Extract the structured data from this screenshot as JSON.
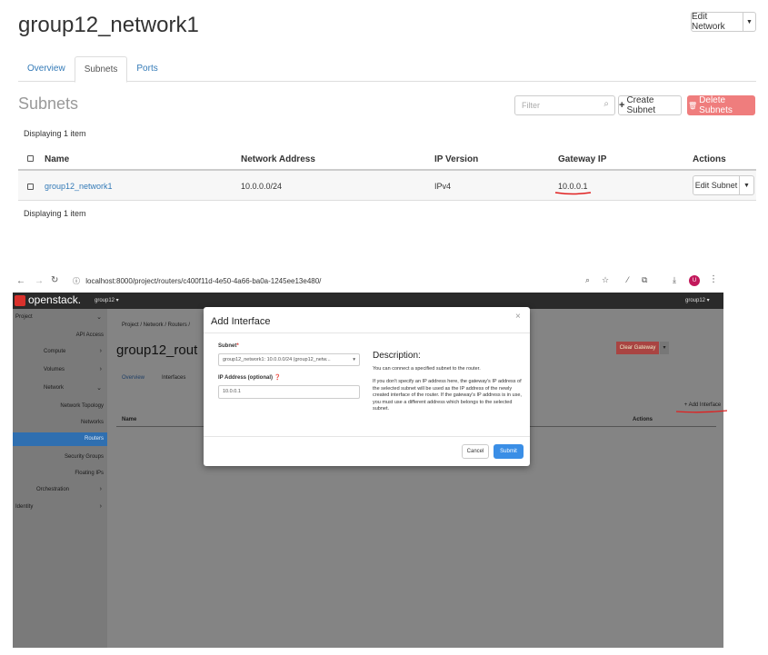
{
  "network": {
    "title": "group12_network1",
    "edit_button": "Edit Network",
    "tabs": [
      "Overview",
      "Subnets",
      "Ports"
    ],
    "active_tab": "Subnets"
  },
  "subnets": {
    "section_title": "Subnets",
    "filter_placeholder": "Filter",
    "create_button": "Create Subnet",
    "delete_button": "Delete Subnets",
    "display_count": "Displaying 1 item",
    "columns": [
      "Name",
      "Network Address",
      "IP Version",
      "Gateway IP",
      "Actions"
    ],
    "rows": [
      {
        "name": "group12_network1",
        "network_address": "10.0.0.0/24",
        "ip_version": "IPv4",
        "gateway_ip": "10.0.0.1",
        "action": "Edit Subnet"
      }
    ]
  },
  "browser": {
    "url": "localhost:8000/project/routers/c400f11d-4e50-4a66-ba0a-1245ee13e480/",
    "profile_initial": "U"
  },
  "openstack": {
    "logo": "openstack.",
    "project_selector": "group12 ▾",
    "user_menu": "group12 ▾",
    "sidebar": [
      {
        "label": "Project",
        "chev": "⌄"
      },
      {
        "label": "API Access",
        "chev": ""
      },
      {
        "label": "Compute",
        "chev": "›"
      },
      {
        "label": "Volumes",
        "chev": "›"
      },
      {
        "label": "Network",
        "chev": "⌄"
      },
      {
        "label": "Network Topology",
        "chev": ""
      },
      {
        "label": "Networks",
        "chev": ""
      },
      {
        "label": "Routers",
        "chev": ""
      },
      {
        "label": "Security Groups",
        "chev": ""
      },
      {
        "label": "Floating IPs",
        "chev": ""
      },
      {
        "label": "Orchestration",
        "chev": "›"
      },
      {
        "label": "Identity",
        "chev": "›"
      }
    ],
    "breadcrumb": "Project / Network / Routers /",
    "router_title": "group12_rout",
    "router_tabs": [
      "Overview",
      "Interfaces"
    ],
    "clear_gateway": "Clear Gateway",
    "add_interface": "+ Add Interface",
    "table_name_col": "Name",
    "table_actions_col": "Actions"
  },
  "modal": {
    "title": "Add Interface",
    "close": "×",
    "subnet_label": "Subnet",
    "subnet_value": "group12_network1: 10.0.0.0/24 (group12_netw...",
    "ip_label": "IP Address (optional)",
    "ip_value": "10.0.0.1",
    "desc_title": "Description:",
    "desc_p1": "You can connect a specified subnet to the router.",
    "desc_p2": "If you don't specify an IP address here, the gateway's IP address of the selected subnet will be used as the IP address of the newly created interface of the router. If the gateway's IP address is in use, you must use a different address which belongs to the selected subnet.",
    "cancel": "Cancel",
    "submit": "Submit"
  },
  "colors": {
    "link": "#337ab7",
    "danger": "#ef7d7d",
    "annotation": "#e02020",
    "os_active": "#2f6fb0",
    "submit": "#3a8ee6"
  }
}
